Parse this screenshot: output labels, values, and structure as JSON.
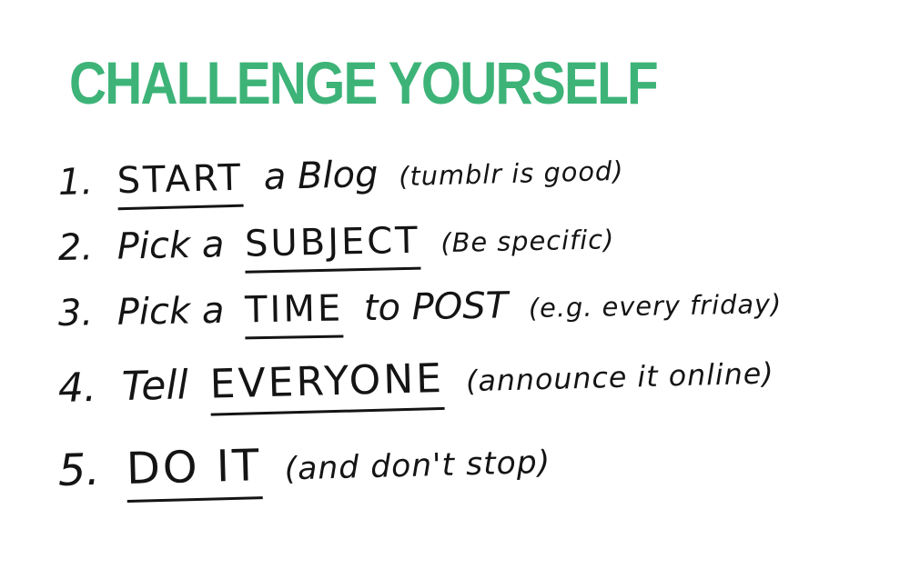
{
  "title": {
    "text": "CHALLENGE YOURSELF",
    "color": "#3db378"
  },
  "items": [
    {
      "number": "1.",
      "pre": "",
      "keyword": "START",
      "post": "a Blog",
      "note": "(tumblr is good)"
    },
    {
      "number": "2.",
      "pre": "Pick a",
      "keyword": "SUBJECT",
      "post": "",
      "note": "(Be specific)"
    },
    {
      "number": "3.",
      "pre": "Pick a",
      "keyword": "TIME",
      "post": "to POST",
      "note": "(e.g. every friday)"
    },
    {
      "number": "4.",
      "pre": "Tell",
      "keyword": "EVERYONE",
      "post": "",
      "note": "(announce it online)"
    },
    {
      "number": "5.",
      "pre": "",
      "keyword": "DO IT",
      "post": "",
      "note": "(and don't stop)"
    }
  ]
}
